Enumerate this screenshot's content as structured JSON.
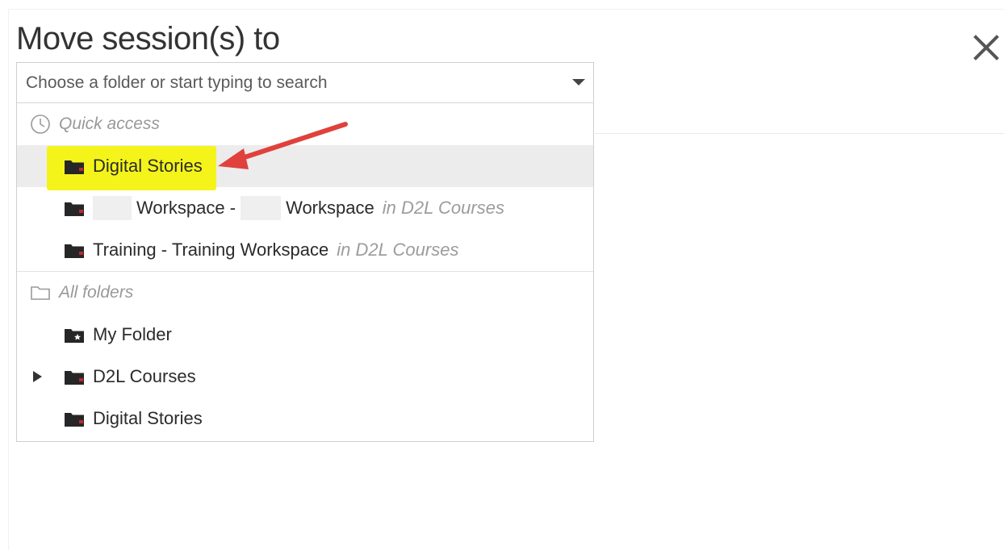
{
  "dialog": {
    "title": "Move session(s) to",
    "close_icon": "close-icon"
  },
  "search": {
    "placeholder": "Choose a folder or start typing to search",
    "value": "",
    "toggle_icon": "caret-down-icon"
  },
  "quick_access": {
    "label": "Quick access",
    "icon": "clock-icon",
    "items": [
      {
        "name": "Digital Stories",
        "location": "",
        "icon": "folder-icon",
        "highlighted": true
      },
      {
        "name_part1": "Workspace -",
        "name_part2": "Workspace",
        "location": "in D2L Courses",
        "icon": "folder-icon"
      },
      {
        "name": "Training - Training Workspace",
        "location": "in D2L Courses",
        "icon": "folder-icon"
      }
    ]
  },
  "all_folders": {
    "label": "All folders",
    "icon": "folder-outline-icon",
    "items": [
      {
        "name": "My Folder",
        "icon": "folder-star-icon"
      },
      {
        "name": "D2L Courses",
        "icon": "folder-icon",
        "expandable": true
      },
      {
        "name": "Digital Stories",
        "icon": "folder-icon"
      }
    ]
  },
  "colors": {
    "highlight": "#f4f41b",
    "arrow": "#e0413c",
    "folder": "#262626",
    "folder_tab": "#c0272d"
  }
}
